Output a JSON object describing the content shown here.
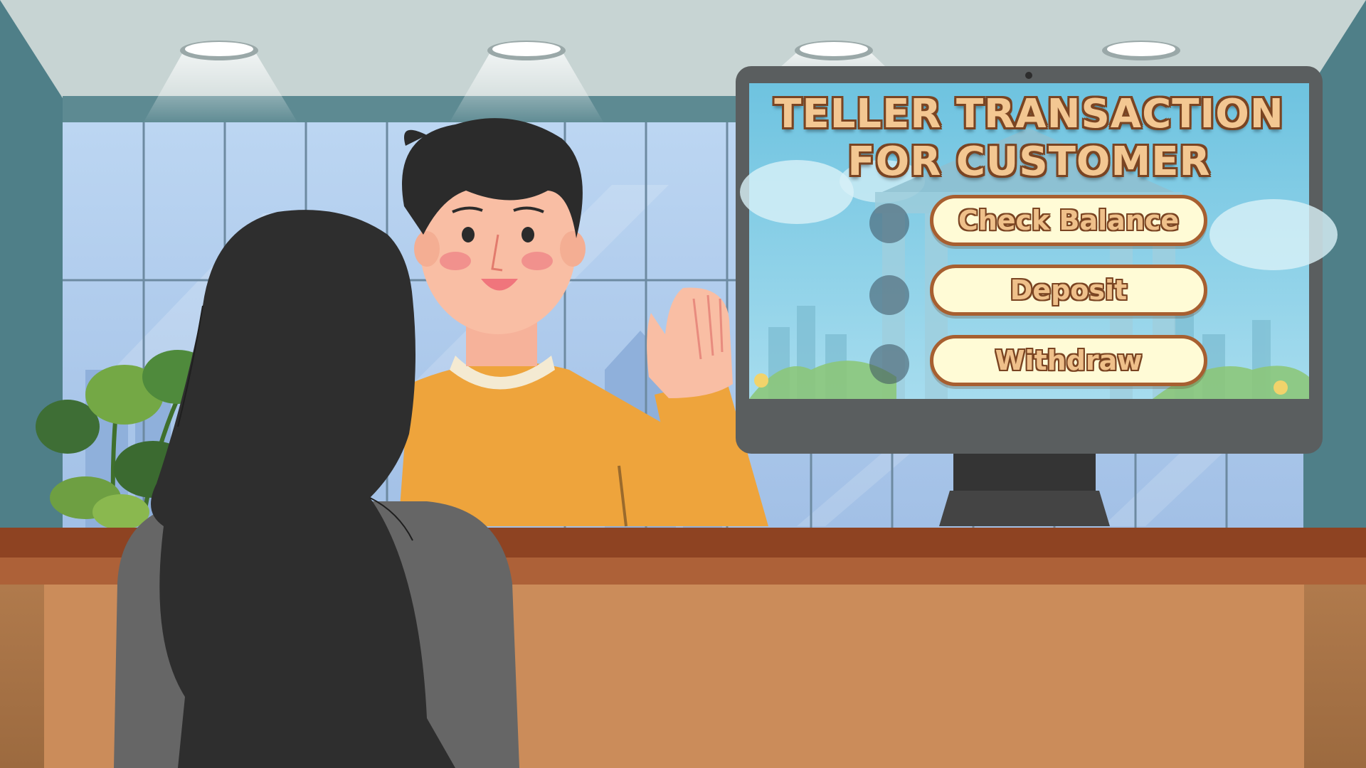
{
  "screen": {
    "title_line1": "TELLER TRANSACTION",
    "title_line2": "FOR CUSTOMER"
  },
  "menu": [
    {
      "label": "Check Balance",
      "icon": "check-balance"
    },
    {
      "label": "Deposit",
      "icon": "deposit"
    },
    {
      "label": "Withdraw",
      "icon": "withdraw"
    }
  ],
  "colors": {
    "title_fill": "#f3c792",
    "outline": "#7a4422",
    "button_fill": "#fffbd6",
    "button_border": "#a75f30",
    "shirt": "#eea43c",
    "counter": "#cb8c5a"
  }
}
